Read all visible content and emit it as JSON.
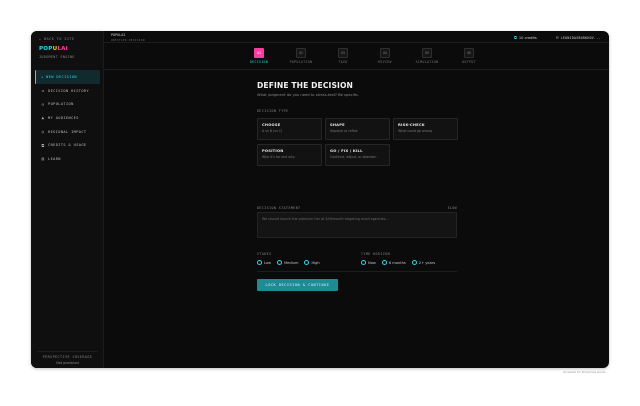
{
  "sidebar": {
    "back_label": "← BACK TO SITE",
    "logo_parts": [
      "POP",
      "U",
      "LAI"
    ],
    "tagline": "JUDGMENT ENGINE",
    "items": [
      {
        "label": "+ NEW DECISION",
        "icon": "plus-icon",
        "glyph": ""
      },
      {
        "label": "DECISION HISTORY",
        "icon": "history-icon",
        "glyph": "↺"
      },
      {
        "label": "POPULATION",
        "icon": "user-icon",
        "glyph": "☺"
      },
      {
        "label": "MY AUDIENCES",
        "icon": "audience-icon",
        "glyph": "▲"
      },
      {
        "label": "REGIONAL IMPACT",
        "icon": "globe-icon",
        "glyph": "◎"
      },
      {
        "label": "CREDITS & USAGE",
        "icon": "credits-icon",
        "glyph": "⧉"
      },
      {
        "label": "LEARN",
        "icon": "book-icon",
        "glyph": "▤"
      }
    ],
    "coverage_title": "PERSPECTIVE COVERAGE",
    "coverage_value": "Not predicted"
  },
  "topbar": {
    "project": "POPULAI",
    "project_sub": "UNTITLED DECISION",
    "credits_icon": "link-icon",
    "credits": "10 credits",
    "user": "LEONIDASBARKHOV..."
  },
  "steps": [
    {
      "num": "01",
      "label": "DECISION"
    },
    {
      "num": "02",
      "label": "POPULATION"
    },
    {
      "num": "03",
      "label": "TASK"
    },
    {
      "num": "04",
      "label": "REVIEW"
    },
    {
      "num": "05",
      "label": "SIMULATION"
    },
    {
      "num": "06",
      "label": "OUTPUT"
    }
  ],
  "main": {
    "title": "DEFINE THE DECISION",
    "subtitle": "What judgment do you need to stress-test? Be specific.",
    "decision_type_label": "DECISION TYPE",
    "types": [
      {
        "title": "CHOOSE",
        "desc": "A vs B (vs C)"
      },
      {
        "title": "SHAPE",
        "desc": "Improve or refine"
      },
      {
        "title": "RISK-CHECK",
        "desc": "What could go wrong"
      },
      {
        "title": "POSITION",
        "desc": "Who it's for and why"
      },
      {
        "title": "GO / FIX / KILL",
        "desc": "Continue, adjust, or abandon"
      }
    ],
    "statement_label": "DECISION STATEMENT",
    "statement_hint": "SLOW",
    "statement_placeholder": "We should launch the premium tier at $49/month targeting small agencies...",
    "stakes_label": "STAKES",
    "stakes_options": [
      "Low",
      "Medium",
      "High"
    ],
    "horizon_label": "TIME HORIZON",
    "horizon_options": [
      "Now",
      "6 months",
      "2+ years"
    ],
    "cta": "LOCK DECISION & CONTINUE"
  },
  "footer_note": "Accessed for Enterprise Grade"
}
